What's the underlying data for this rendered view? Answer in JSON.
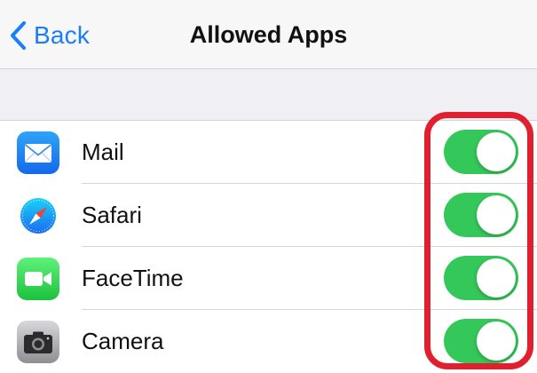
{
  "navbar": {
    "back_label": "Back",
    "title": "Allowed Apps"
  },
  "apps": [
    {
      "name": "Mail",
      "icon": "mail-icon",
      "enabled": true
    },
    {
      "name": "Safari",
      "icon": "safari-icon",
      "enabled": true
    },
    {
      "name": "FaceTime",
      "icon": "facetime-icon",
      "enabled": true
    },
    {
      "name": "Camera",
      "icon": "camera-icon",
      "enabled": true
    }
  ],
  "colors": {
    "accent": "#1a7ef5",
    "toggle_on": "#34c759",
    "highlight": "#e0202e"
  }
}
